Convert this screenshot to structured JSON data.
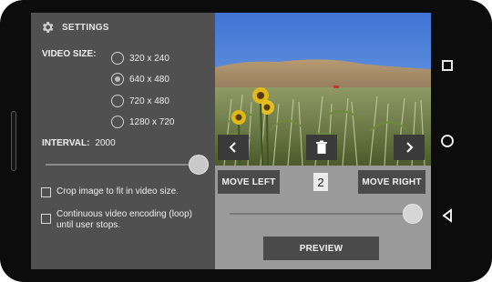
{
  "settings": {
    "title": "SETTINGS",
    "video_size_label": "VIDEO SIZE:",
    "video_sizes": [
      {
        "label": "320 x 240",
        "selected": false
      },
      {
        "label": "640 x 480",
        "selected": true
      },
      {
        "label": "720 x 480",
        "selected": false
      },
      {
        "label": "1280 x 720",
        "selected": false
      }
    ],
    "interval_label": "INTERVAL:",
    "interval_value": "2000",
    "interval_slider_fraction": 1.0,
    "crop_label": "Crop image to fit in video size.",
    "loop_label_line1": "Continuous video encoding (loop)",
    "loop_label_line2": "until user stops."
  },
  "preview": {
    "move_left_label": "MOVE LEFT",
    "move_right_label": "MOVE RIGHT",
    "frame_index": "2",
    "preview_label": "PREVIEW",
    "frame_slider_fraction": 1.0
  },
  "icons": {
    "settings": "gear-icon",
    "prev": "chevron-left-icon",
    "delete": "trash-icon",
    "next": "chevron-right-icon",
    "nav_recent": "square-icon",
    "nav_home": "circle-icon",
    "nav_back": "triangle-back-icon"
  }
}
